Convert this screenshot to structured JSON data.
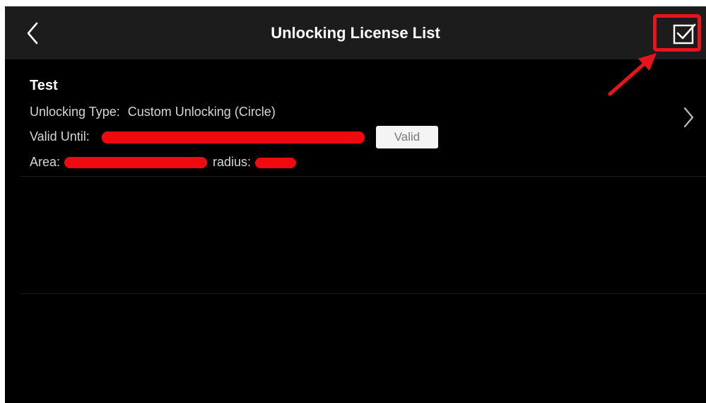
{
  "header": {
    "title": "Unlocking License List",
    "back_icon": "chevron-left-icon",
    "confirm_icon": "checkbox-checked-icon"
  },
  "license_items": [
    {
      "name": "Test",
      "type_label": "Unlocking Type:",
      "type_value": "Custom Unlocking (Circle)",
      "valid_until_label": "Valid Until:",
      "status_badge": "Valid",
      "area_label": "Area:",
      "radius_label": "radius:"
    }
  ],
  "colors": {
    "background": "#000000",
    "header_bar": "#1c1c1c",
    "annotation_red": "#e8141b",
    "badge_bg": "#f4f4f4"
  }
}
